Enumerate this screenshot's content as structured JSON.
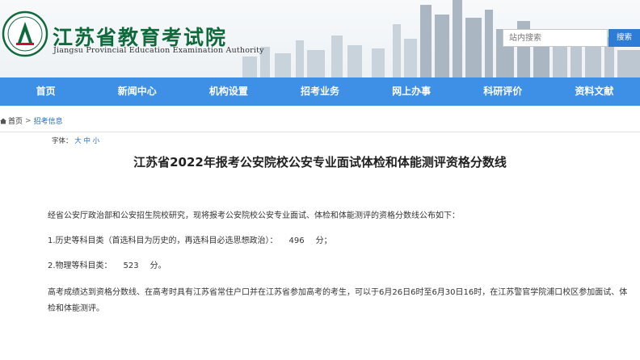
{
  "header": {
    "title": "江苏省教育考试院",
    "subtitle": "Jiangsu Provincial Education Examination Authority",
    "search_placeholder": "站内搜索",
    "search_button": "搜索"
  },
  "nav": {
    "items": [
      "首页",
      "新闻中心",
      "机构设置",
      "招考业务",
      "网上办事",
      "科研评价",
      "资料文献"
    ]
  },
  "breadcrumb": {
    "home": "首页",
    "separator": ">",
    "current": "招考信息"
  },
  "font_size": {
    "label": "字体：",
    "large": "大",
    "medium": "中",
    "small": "小"
  },
  "article": {
    "title": "江苏省2022年报考公安院校公安专业面试体检和体能测评资格分数线",
    "intro": "经省公安厅政治部和公安招生院校研究，现将报考公安院校公安专业面试、体检和体能测评的资格分数线公布如下：",
    "item1_label": "1.历史等科目类（首选科目为历史的，再选科目必选思想政治）：",
    "item1_value": "496",
    "item1_unit": "分；",
    "item2_label": "2.物理等科目类：",
    "item2_value": "523",
    "item2_unit": "分。",
    "closing": "高考成绩达到资格分数线、在高考时具有江苏省常住户口并在江苏省参加高考的考生，可以于6月26日6时至6月30日16时，在江苏警官学院浦口校区参加面试、体检和体能测评。"
  },
  "colors": {
    "brand_green": "#0e6a3a",
    "nav_blue": "#3e8fe6",
    "search_button_blue": "#2d7cd6",
    "link_blue": "#2b6cb8"
  }
}
